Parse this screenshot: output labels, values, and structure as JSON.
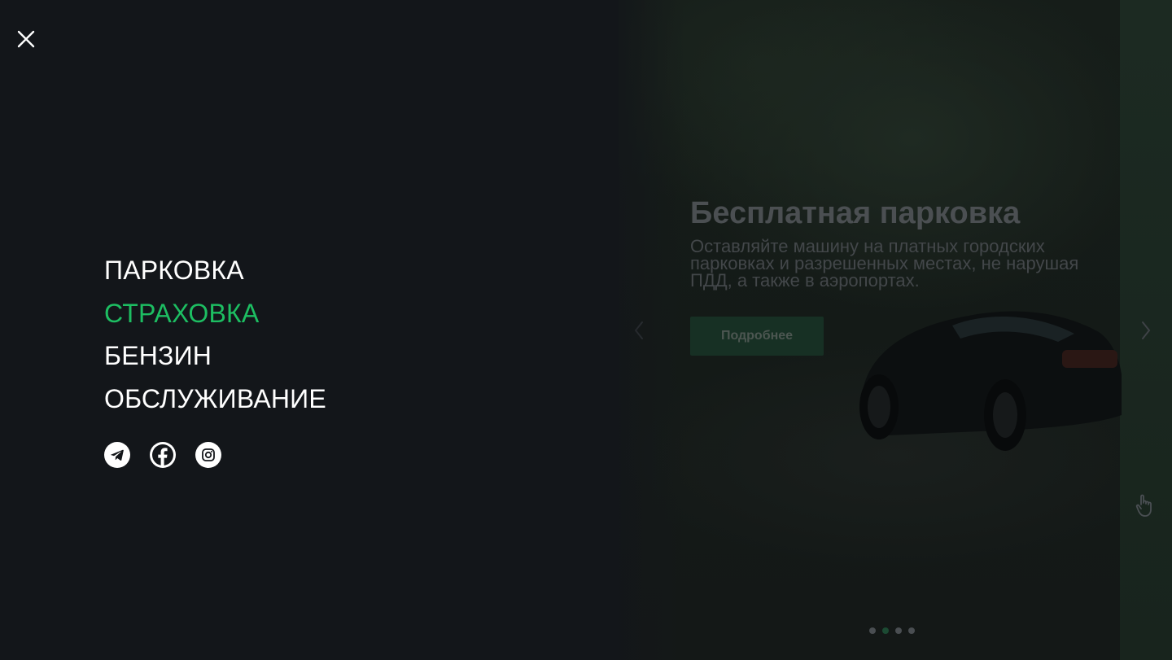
{
  "menu": {
    "items": [
      {
        "label": "ПАРКОВКА",
        "active": false
      },
      {
        "label": "СТРАХОВКА",
        "active": true
      },
      {
        "label": "БЕНЗИН",
        "active": false
      },
      {
        "label": "ОБСЛУЖИВАНИЕ",
        "active": false
      }
    ],
    "active_color": "#1dbe62",
    "socials": [
      {
        "icon": "telegram-icon"
      },
      {
        "icon": "facebook-icon"
      },
      {
        "icon": "instagram-icon"
      }
    ],
    "close_icon": "close-icon"
  },
  "hero": {
    "title": "Бесплатная парковка",
    "description": "Оставляйте машину на платных городских парковках и разрешенных местах, не нарушая ПДД, а также в аэропортах.",
    "button_label": "Подробнее",
    "slides_total": 4,
    "active_slide": 2
  }
}
